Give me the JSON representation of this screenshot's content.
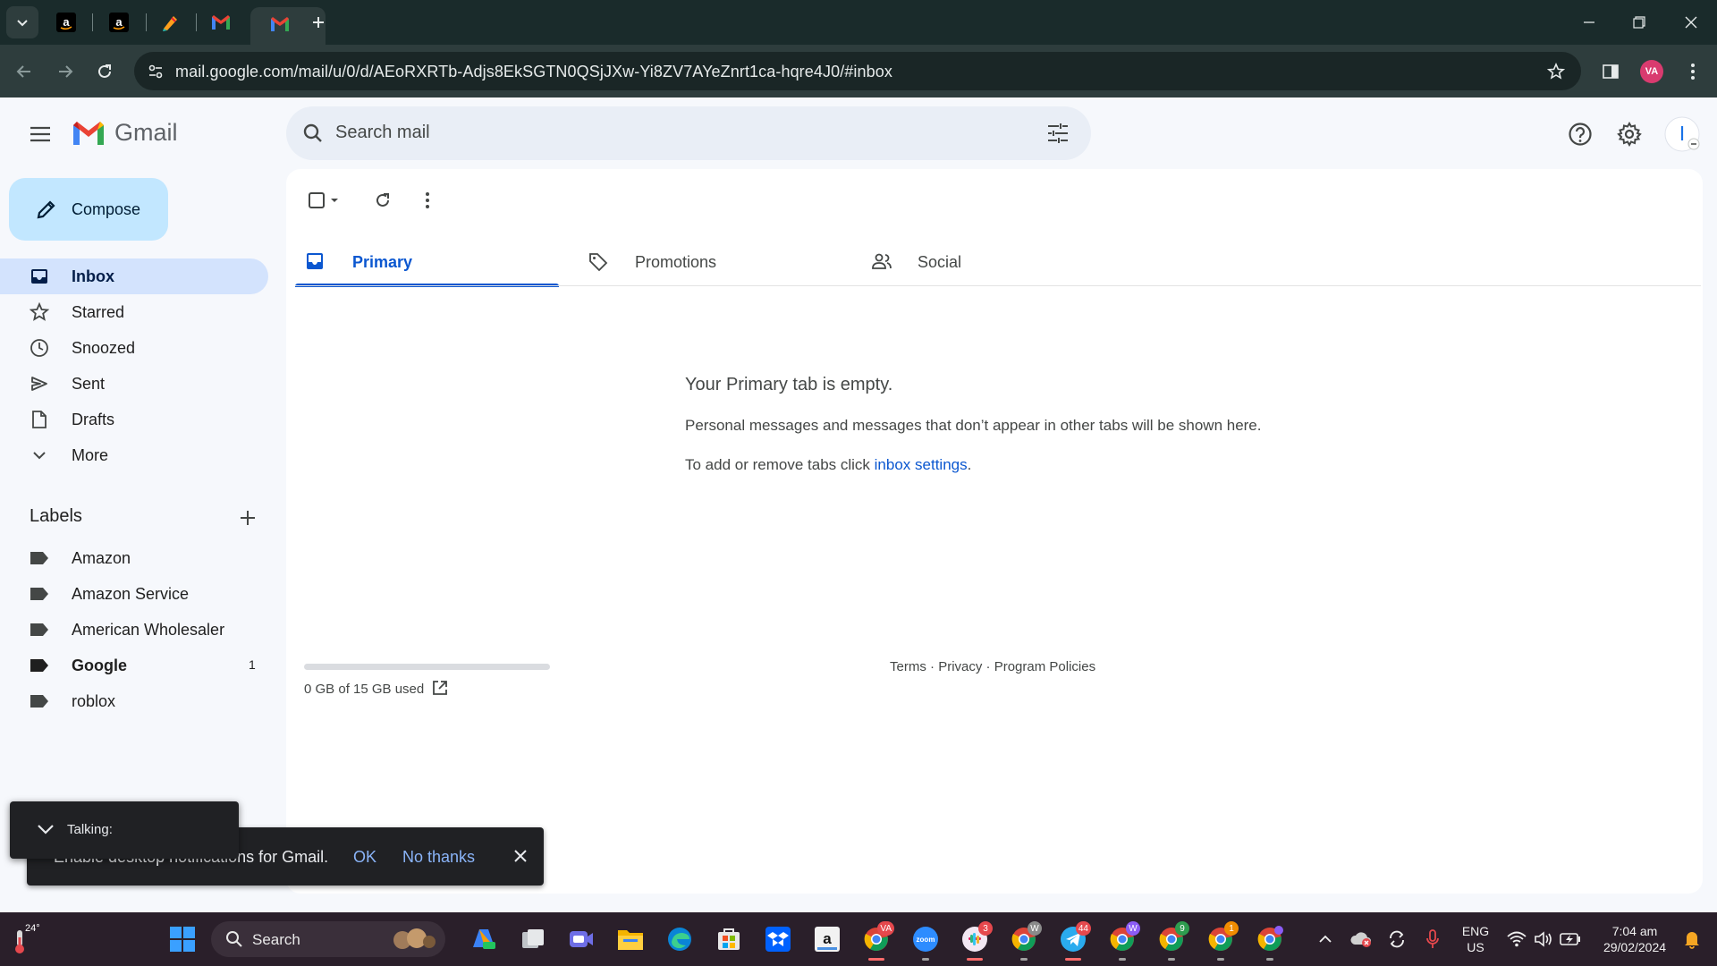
{
  "browser": {
    "url": "mail.google.com/mail/u/0/d/AEoRXRTb-Adjs8EkSGTN0QSjJXw-Yi8ZV7AYeZnrt1ca-hqre4J0/#inbox",
    "profile_initials": "VA"
  },
  "gmail": {
    "logo_text": "Gmail",
    "search_placeholder": "Search mail",
    "compose_label": "Compose",
    "nav": [
      {
        "label": "Inbox"
      },
      {
        "label": "Starred"
      },
      {
        "label": "Snoozed"
      },
      {
        "label": "Sent"
      },
      {
        "label": "Drafts"
      },
      {
        "label": "More"
      }
    ],
    "labels_title": "Labels",
    "labels": [
      {
        "label": "Amazon",
        "count": ""
      },
      {
        "label": "Amazon Service",
        "count": ""
      },
      {
        "label": "American Wholesaler",
        "count": ""
      },
      {
        "label": "Google",
        "count": "1"
      },
      {
        "label": "roblox",
        "count": ""
      }
    ],
    "tabs": [
      {
        "label": "Primary"
      },
      {
        "label": "Promotions"
      },
      {
        "label": "Social"
      }
    ],
    "empty_title": "Your Primary tab is empty.",
    "empty_line1": "Personal messages and messages that don’t appear in other tabs will be shown here.",
    "empty_line2_prefix": "To add or remove tabs click ",
    "empty_line2_link": "inbox settings",
    "empty_line2_suffix": ".",
    "storage_text": "0 GB of 15 GB used",
    "storage_fraction": 0,
    "footer_terms": "Terms",
    "footer_privacy": "Privacy",
    "footer_policies": "Program Policies",
    "footer_sep": " · "
  },
  "notification": {
    "message": "Enable desktop notifications for Gmail.",
    "ok": "OK",
    "no_thanks": "No thanks"
  },
  "talking": {
    "label": "Talking:"
  },
  "taskbar": {
    "weather": "24°",
    "search_label": "Search",
    "lang_top": "ENG",
    "lang_bottom": "US",
    "time": "7:04 am",
    "date": "29/02/2024",
    "badges": {
      "chrome1": "VA",
      "slack": "3",
      "chrome2": "W",
      "telegram": "44",
      "chrome3": "W",
      "chrome4": "9",
      "chrome5": "1"
    }
  },
  "colors": {
    "accent": "#0b57d0",
    "compose_bg": "#c2e7ff",
    "active_nav_bg": "#d3e3fd",
    "main_bg": "#ffffff",
    "app_bg": "#f6f8fc"
  }
}
